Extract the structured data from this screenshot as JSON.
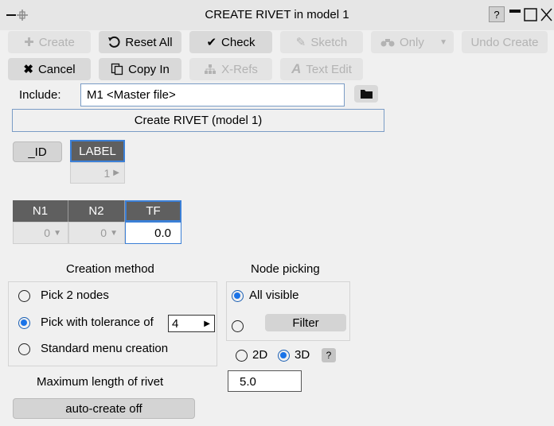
{
  "window": {
    "title": "CREATE RIVET in model 1",
    "help_label": "?"
  },
  "toolbar": {
    "create_label": "Create",
    "reset_all_label": "Reset All",
    "check_label": "Check",
    "sketch_label": "Sketch",
    "only_label": "Only",
    "undo_create_label": "Undo Create",
    "cancel_label": "Cancel",
    "copy_in_label": "Copy In",
    "xrefs_label": "X-Refs",
    "text_edit_label": "Text Edit"
  },
  "include": {
    "label": "Include:",
    "value": "M1  <Master file>"
  },
  "create_header": "Create RIVET (model 1)",
  "id_section": {
    "id_button": "_ID",
    "label_header": "LABEL",
    "label_value": "1"
  },
  "node_table": {
    "headers": [
      "N1",
      "N2",
      "TF"
    ],
    "n1_value": "0",
    "n2_value": "0",
    "tf_value": "0.0"
  },
  "creation_method": {
    "title": "Creation method",
    "options": [
      "Pick 2 nodes",
      "Pick with tolerance of",
      "Standard menu creation"
    ],
    "selected": "Pick with tolerance of",
    "tolerance_value": "4"
  },
  "node_picking": {
    "title": "Node picking",
    "all_visible_label": "All visible",
    "filter_label": "Filter",
    "selected": "All visible",
    "dim_2d_label": "2D",
    "dim_3d_label": "3D",
    "dim_selected": "3D",
    "help_label": "?"
  },
  "max_length": {
    "label": "Maximum length of rivet",
    "value": "5.0"
  },
  "auto_create_label": "auto-create off"
}
